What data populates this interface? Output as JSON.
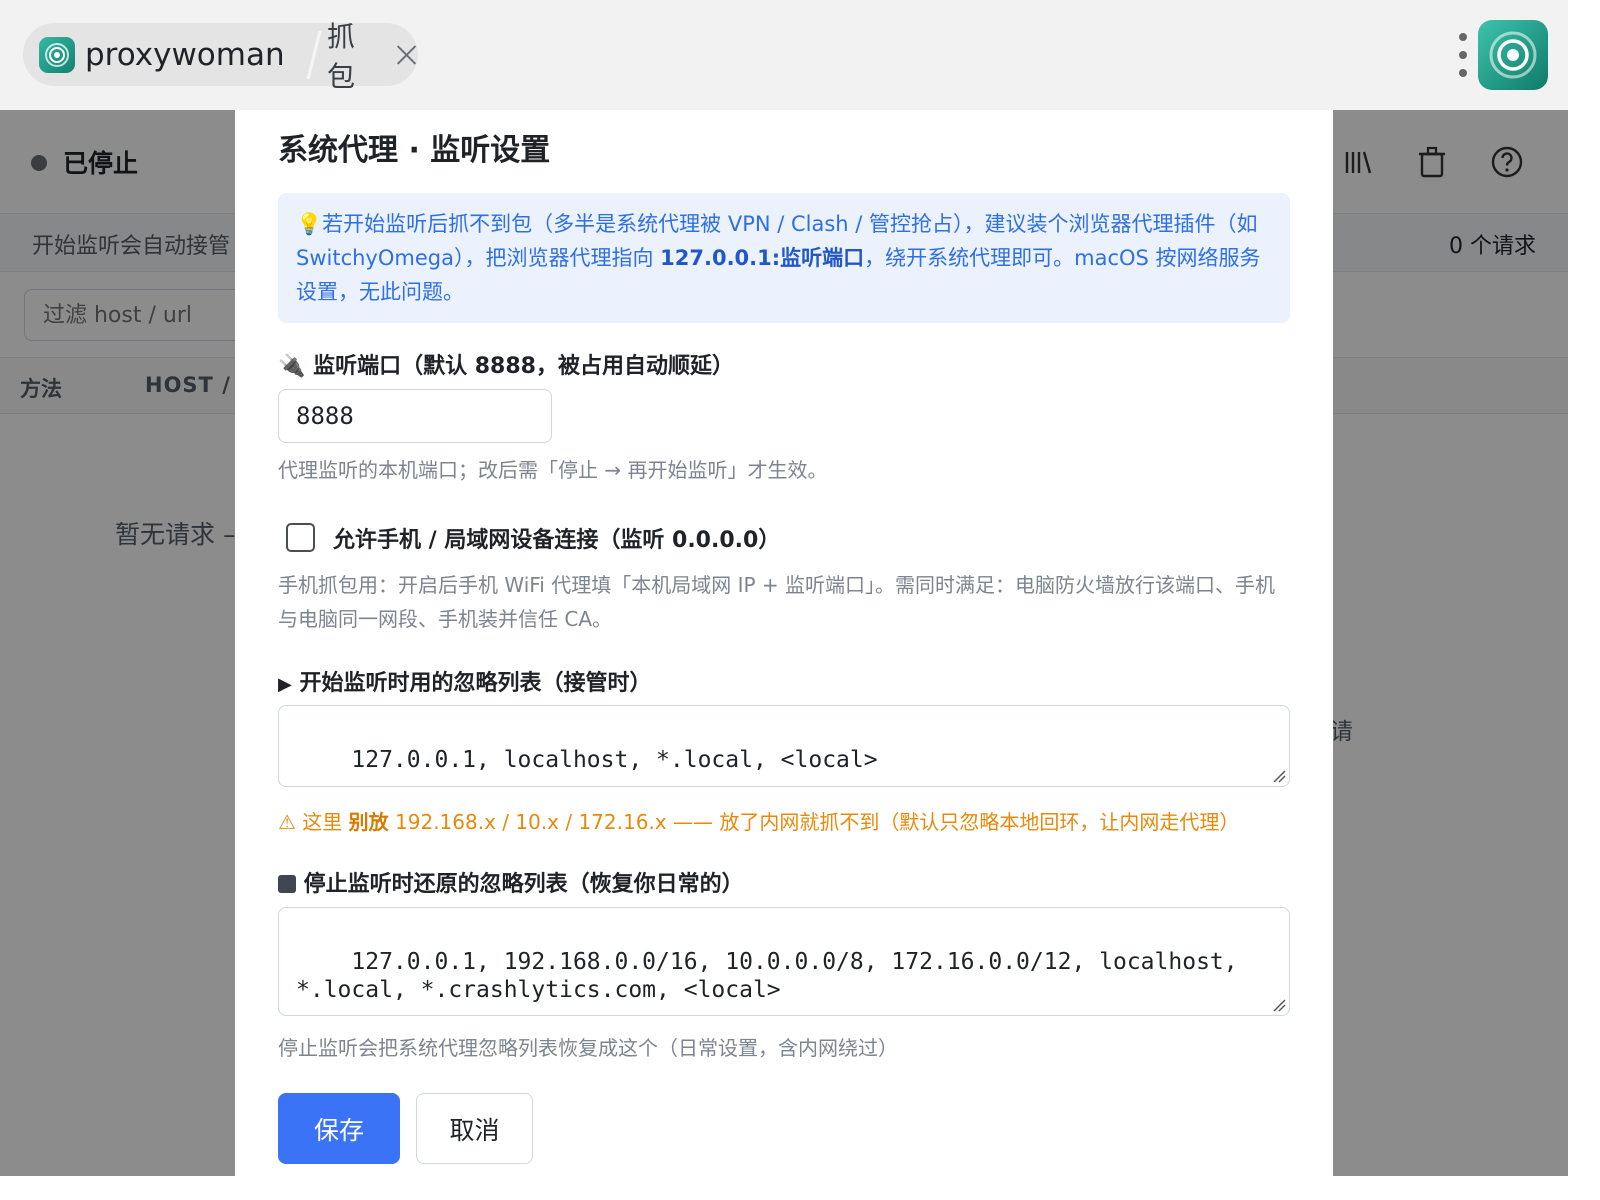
{
  "tabs": {
    "app_label": "proxywoman",
    "capture_label": "抓包"
  },
  "page": {
    "status": "已停止",
    "info": "开始监听会自动接管",
    "request_count": "0 个请求",
    "filter_placeholder": "过滤 host / url",
    "columns": {
      "method": "方法",
      "host": "HOST / I"
    },
    "empty_text": "暂无请求 –",
    "empty_right": "请"
  },
  "modal": {
    "title": "系统代理 · 监听设置",
    "notice": {
      "icon": "bulb-icon",
      "text_1": "若开始监听后抓不到包（多半是系统代理被 VPN / Clash / 管控抢占），建议装个浏览器代理插件（如 SwitchyOmega），把浏览器代理指向 ",
      "bold": "127.0.0.1:监听端口",
      "text_2": "，绕开系统代理即可。macOS 按网络服务设置，无此问题。"
    },
    "port": {
      "icon": "plug-icon",
      "label": "监听端口（默认 8888，被占用自动顺延）",
      "value": "8888",
      "help": "代理监听的本机端口；改后需「停止 → 再开始监听」才生效。"
    },
    "lan": {
      "label": "允许手机 / 局域网设备连接（监听 0.0.0.0）",
      "checked": false,
      "help": "手机抓包用：开启后手机 WiFi 代理填「本机局域网 IP + 监听端口」。需同时满足：电脑防火墙放行该端口、手机与电脑同一网段、手机装并信任 CA。"
    },
    "start_bypass": {
      "icon": "play-icon",
      "label": "开始监听时用的忽略列表（接管时）",
      "value": "127.0.0.1, localhost, *.local, <local>"
    },
    "warning": {
      "prefix": "这里 ",
      "bold": "别放",
      "text": " 192.168.x / 10.x / 172.16.x —— 放了内网就抓不到（默认只忽略本地回环，让内网走代理）",
      "color": "#e8890c"
    },
    "stop_bypass": {
      "icon": "stop-icon",
      "label": "停止监听时还原的忽略列表（恢复你日常的）",
      "value": "127.0.0.1, 192.168.0.0/16, 10.0.0.0/8, 172.16.0.0/12, localhost, *.local, *.crashlytics.com, <local>",
      "help": "停止监听会把系统代理忽略列表恢复成这个（日常设置，含内网绕过）"
    },
    "buttons": {
      "save": "保存",
      "cancel": "取消"
    }
  },
  "colors": {
    "primary": "#3b73f6",
    "notice_bg": "#ebf2fe",
    "notice_text": "#2f6fe4",
    "warning": "#e8890c",
    "app_teal": "#1a9c86"
  }
}
